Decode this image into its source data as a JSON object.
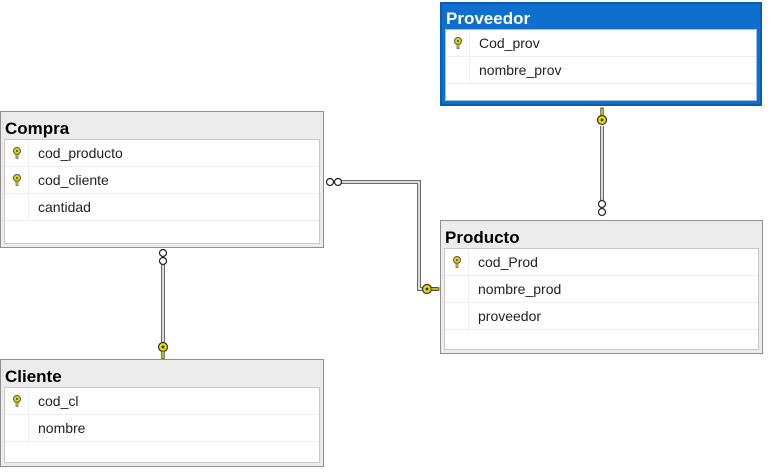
{
  "tables": {
    "proveedor": {
      "title": "Proveedor",
      "columns": [
        {
          "name": "Cod_prov",
          "key": true
        },
        {
          "name": "nombre_prov",
          "key": false
        }
      ]
    },
    "compra": {
      "title": "Compra",
      "columns": [
        {
          "name": "cod_producto",
          "key": true
        },
        {
          "name": "cod_cliente",
          "key": true
        },
        {
          "name": "cantidad",
          "key": false
        }
      ]
    },
    "producto": {
      "title": "Producto",
      "columns": [
        {
          "name": "cod_Prod",
          "key": true
        },
        {
          "name": "nombre_prod",
          "key": false
        },
        {
          "name": "proveedor",
          "key": false
        }
      ]
    },
    "cliente": {
      "title": "Cliente",
      "columns": [
        {
          "name": "cod_cl",
          "key": true
        },
        {
          "name": "nombre",
          "key": false
        }
      ]
    }
  },
  "selected_table": "proveedor",
  "colors": {
    "selected_header": "#0f6fcf",
    "key_icon": "#e8d800",
    "relationship_line": "#808080"
  },
  "icons": {
    "primary_key": "key-icon",
    "one_end": "key-icon",
    "many_end": "infinity-icon"
  }
}
